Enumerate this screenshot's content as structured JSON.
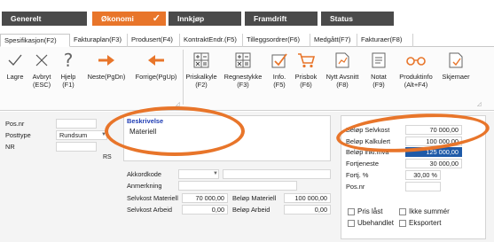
{
  "nav": {
    "generelt": "Generelt",
    "okonomi": "Økonomi",
    "okonomi_check": "✓",
    "innkjop": "Innkjøp",
    "framdrift": "Framdrift",
    "status": "Status"
  },
  "tabs": [
    "Spesifikasjon(F2)",
    "Fakturaplan(F3)",
    "Produsert(F4)",
    "KontraktEndr.(F5)",
    "Tilleggsordrer(F6)",
    "Medgått(F7)",
    "Fakturaer(F8)"
  ],
  "ribbon": {
    "lagre": "Lagre",
    "avbryt1": "Avbryt",
    "avbryt2": "(ESC)",
    "hjelp1": "Hjelp",
    "hjelp2": "(F1)",
    "neste": "Neste(PgDn)",
    "forrige": "Forrige(PgUp)",
    "priskalkyle1": "Priskalkyle",
    "priskalkyle2": "(F2)",
    "regnestykke1": "Regnestykke",
    "regnestykke2": "(F3)",
    "info1": "Info.",
    "info2": "(F5)",
    "prisbok1": "Prisbok",
    "prisbok2": "(F6)",
    "nytt1": "Nytt Avsnitt",
    "nytt2": "(F8)",
    "notat1": "Notat",
    "notat2": "(F9)",
    "produktinfo1": "Produktinfo",
    "produktinfo2": "(Alt+F4)",
    "skjemaer": "Skjemaer"
  },
  "left": {
    "posnr_label": "Pos.nr",
    "posnr_value": "",
    "posttype_label": "Posttype",
    "posttype_value": "Rundsum",
    "nr_label": "NR",
    "nr_value": "",
    "rs": "RS"
  },
  "beskrivelse": {
    "label": "Beskrivelse",
    "value": "Materiell"
  },
  "middle": {
    "akkordkode_label": "Akkordkode",
    "anmerkning_label": "Anmerkning",
    "selvkost_materiell_label": "Selvkost Materiell",
    "selvkost_materiell_value": "70 000,00",
    "belop_materiell_label": "Beløp Materiell",
    "belop_materiell_value": "100 000,00",
    "selvkost_arbeid_label": "Selvkost Arbeid",
    "selvkost_arbeid_value": "0,00",
    "belop_arbeid_label": "Beløp Arbeid",
    "belop_arbeid_value": "0,00"
  },
  "right": {
    "belop_selvkost_label": "Beløp Selvkost",
    "belop_selvkost_value": "70 000,00",
    "belop_kalkulert_label": "Beløp Kalkulert",
    "belop_kalkulert_value": "100 000,00",
    "belop_inkl_mva_label": "Beløp inkl.mva",
    "belop_inkl_mva_value": "125 000,00",
    "fortjeneste_label": "Fortjeneste",
    "fortjeneste_value": "30 000,00",
    "fortj_pct_label": "Fortj. %",
    "fortj_pct_value": "30,00 %",
    "posnr_label": "Pos.nr",
    "pris_last": "Pris låst",
    "ikke_summer": "Ikke summér",
    "ubehandlet": "Ubehandlet",
    "eksportert": "Eksportert"
  },
  "colors": {
    "accent": "#e8752a",
    "nav_dark": "#4a4a4a",
    "selection": "#1e5aa8"
  }
}
